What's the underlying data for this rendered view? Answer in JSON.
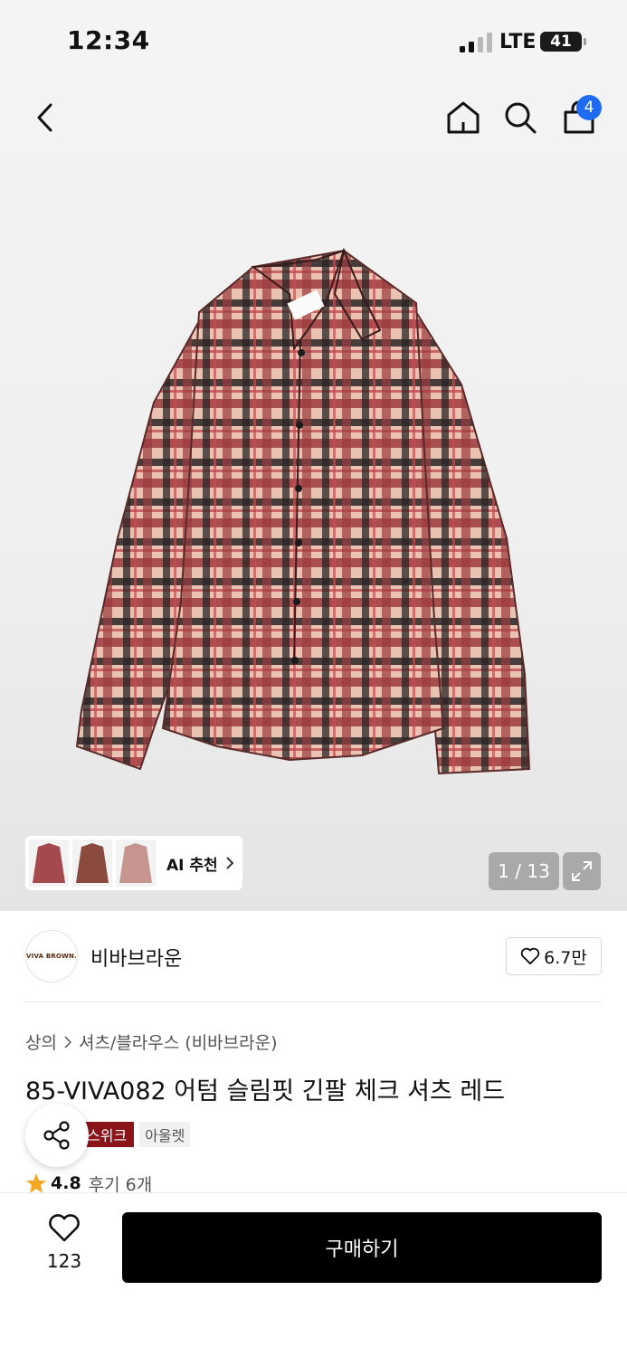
{
  "status_bar": {
    "time": "12:34",
    "network": "LTE",
    "battery": "41"
  },
  "nav": {
    "cart_count": "4",
    "icons": [
      "back-icon",
      "home-icon",
      "search-icon",
      "cart-icon"
    ]
  },
  "gallery": {
    "ai_label": "AI 추천",
    "counter": "1 / 13"
  },
  "brand": {
    "logo_text": "VIVA BROWN.",
    "name": "비바브라운",
    "likes": "6.7만"
  },
  "breadcrumb": {
    "category": "상의",
    "subcategory": "셔츠/블라우스 (비바브라운)"
  },
  "product": {
    "title": "85-VIVA082 어텀 슬림핏 긴팔 체크 셔츠 레드",
    "tags": [
      "스위크",
      "아울렛"
    ],
    "rating": "4.8",
    "reviews": "후기 6개"
  },
  "bottom": {
    "wish_count": "123",
    "buy_label": "구매하기"
  },
  "colors": {
    "accent_blue": "#1e6bf2",
    "tag_red": "#8b1419",
    "star": "#f5a623",
    "buy_bg": "#000000"
  }
}
